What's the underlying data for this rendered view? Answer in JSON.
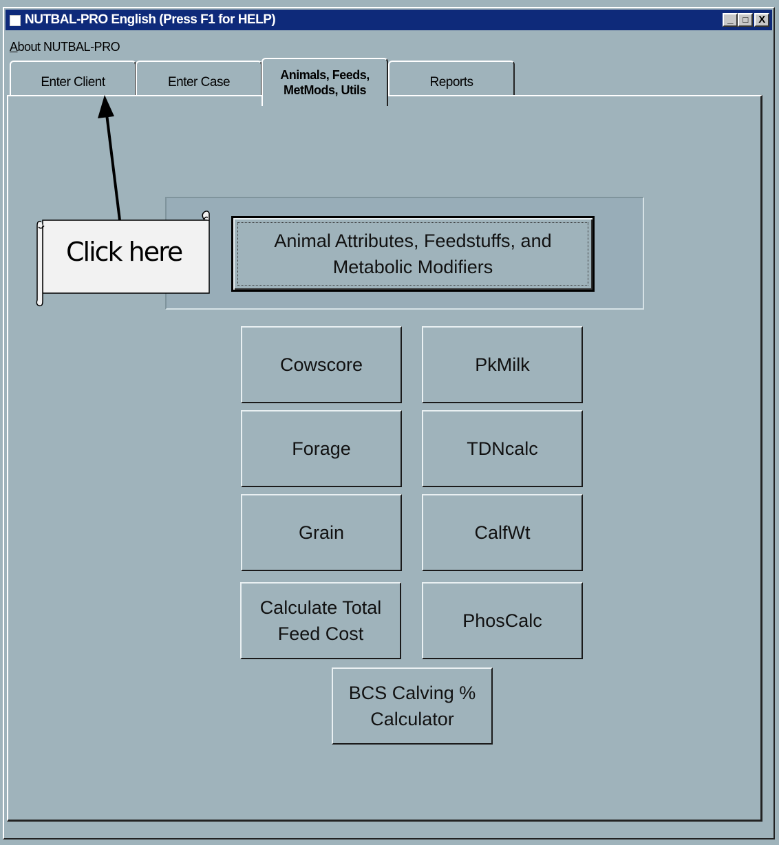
{
  "window": {
    "title": "NUTBAL-PRO English  (Press F1 for HELP)",
    "minimize_glyph": "_",
    "maximize_glyph": "□",
    "close_glyph": "X"
  },
  "menu": {
    "about": "bout NUTBAL-PRO",
    "about_accel": "A"
  },
  "tabs": [
    {
      "label": "Enter Client"
    },
    {
      "label": "Enter Case"
    },
    {
      "label": "Animals, Feeds,\nMetMods, Utils"
    },
    {
      "label": "Reports"
    }
  ],
  "buttons": {
    "animal_attributes": "Animal Attributes, Feedstuffs, and Metabolic Modifiers",
    "cowscore": "Cowscore",
    "pkmilk": "PkMilk",
    "forage": "Forage",
    "tdncalc": "TDNcalc",
    "grain": "Grain",
    "calfwt": "CalfWt",
    "total_feed_cost": "Calculate Total Feed Cost",
    "phoscalc": "PhosCalc",
    "bcs_calving": "BCS Calving % Calculator"
  },
  "annotation": {
    "callout": "Click here"
  },
  "colors": {
    "titlebar": "#0e2a7a",
    "background": "#9fb3bb"
  }
}
